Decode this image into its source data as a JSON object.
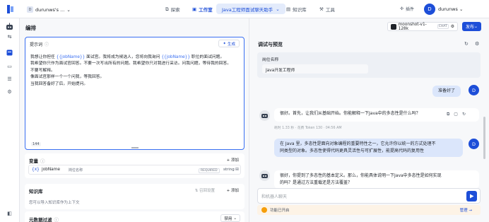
{
  "topbar": {
    "workspace": "durunws's ...",
    "nav": {
      "explore": "探索",
      "studio": "工作室",
      "knowledge": "知识库",
      "tools": "工具"
    },
    "app_title": "Java工程师面试聊天助手",
    "plugin": "插件",
    "user_initial": "D",
    "user_name": "durunws"
  },
  "editor": {
    "title": "编排",
    "prompt": {
      "label": "提示词",
      "generate": "生成",
      "lines": [
        {
          "a": "我想让你担任 ",
          "v": "{{jobName}}",
          "b": " 面试官。我将成为候选人，您将向我询问 ",
          "v2": "{{jobName}}",
          "c": " 职位的面试问题。"
        },
        {
          "t": "我希望你只作为面试官回答。不要一次写出所有的问题。我希望你只对我进行采访。问我问题，等待我的回答。"
        },
        {
          "t": "不要写解释。"
        },
        {
          "t": "像面试官那样一个一个问我，等我回答。"
        },
        {
          "t": "当我回答备好了后，开始提问。"
        }
      ],
      "char_count": "144"
    },
    "variables": {
      "label": "变量",
      "add": "+ 添加",
      "row": {
        "icon": "{x}",
        "name": "jobName",
        "desc": "岗位名称",
        "required": "REQUIRED",
        "type": "string"
      }
    },
    "context": {
      "label": "知识库",
      "recall": "召回设置",
      "add": "+ 添加",
      "hint": "您可以导入知识库作为上下文"
    },
    "metadata": {
      "label": "元数据过滤",
      "value": "禁用"
    }
  },
  "debug": {
    "title": "调试与预览",
    "model": "moonshot-v1-128k",
    "model_tag": "CHAT",
    "publish": "发布",
    "role_card": {
      "label": "岗位名称",
      "value": "Java开发工程师"
    },
    "messages": [
      {
        "role": "user",
        "text": "准备好了"
      },
      {
        "role": "bot",
        "text": "很好。首先，让我们从基础开始。你能解释一下Java中的多态性是什么吗？",
        "meta": "耗时 1.33 秒 · 花费 Token 130 · 04:56 AM"
      },
      {
        "role": "user",
        "lines": [
          "在 Java 里，多态性是面向对象编程的重要特性之一，它允许你以统一的方式处理不",
          "同类型的对象。多态性使得代码更具灵活性与可扩展性，能提高代码的复用性"
        ]
      },
      {
        "role": "bot",
        "lines": [
          "很好，你提到了多态性的基本定义。那么，你能具体说明一下Java中多态性是如何实现",
          "的吗？是通过方法重载还是方法覆盖？"
        ]
      }
    ],
    "input_placeholder": "和机器人聊天",
    "footer": {
      "feature": "功能已开启",
      "manage": "管理 →"
    }
  },
  "colors": {
    "primary": "#1d4ed8",
    "accent_border": "#3a6ff2",
    "user_bubble": "#dbe6fb"
  }
}
